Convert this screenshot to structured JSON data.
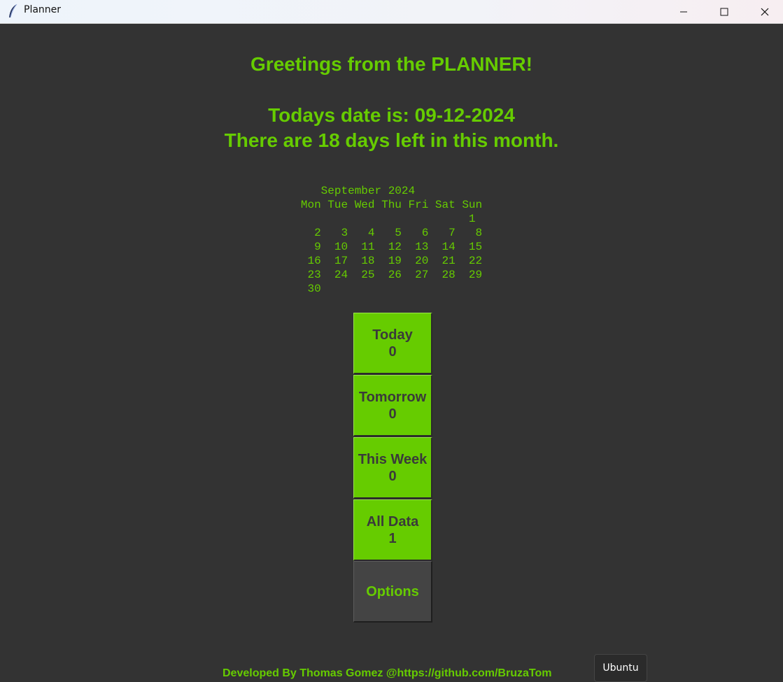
{
  "window": {
    "title": "Planner",
    "icon": "feather-icon",
    "controls": [
      "minimize-icon",
      "maximize-icon",
      "close-icon"
    ]
  },
  "header": {
    "greeting": "Greetings from the PLANNER!",
    "date_line": "Todays date is: 09-12-2024",
    "days_left_line": "There are 18 days left in this month."
  },
  "calendar": {
    "text": "   September 2024\nMon Tue Wed Thu Fri Sat Sun\n                         1\n  2   3   4   5   6   7   8\n  9  10  11  12  13  14  15\n 16  17  18  19  20  21  22\n 23  24  25  26  27  28  29\n 30"
  },
  "buttons": {
    "today": {
      "label": "Today",
      "count": "0"
    },
    "tomorrow": {
      "label": "Tomorrow",
      "count": "0"
    },
    "week": {
      "label": "This Week",
      "count": "0"
    },
    "all": {
      "label": "All Data",
      "count": "1"
    },
    "options": {
      "label": "Options"
    }
  },
  "footer": {
    "text": "Developed By Thomas Gomez @https://github.com/BruzaTom"
  },
  "tooltip": {
    "text": "Ubuntu"
  },
  "colors": {
    "background": "#333333",
    "accent": "#66cc00",
    "button_text": "#3a3a3a",
    "options_bg": "#444444"
  }
}
